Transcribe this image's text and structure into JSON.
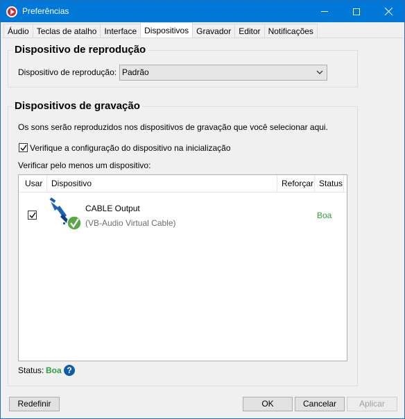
{
  "window": {
    "title": "Preferências"
  },
  "tabs": [
    {
      "label": "Áudio"
    },
    {
      "label": "Teclas de atalho"
    },
    {
      "label": "Interface"
    },
    {
      "label": "Dispositivos",
      "active": true
    },
    {
      "label": "Gravador"
    },
    {
      "label": "Editor"
    },
    {
      "label": "Notificações"
    }
  ],
  "playback": {
    "title": "Dispositivo de reprodução",
    "field_label": "Dispositivo de reprodução:",
    "selected": "Padrão"
  },
  "recording": {
    "title": "Dispositivos de gravação",
    "description": "Os sons serão reproduzidos nos dispositivos de gravação que você selecionar aqui.",
    "verify_startup_label": "Verifique a configuração do dispositivo na inicialização",
    "verify_startup_checked": true,
    "verify_one_label": "Verificar pelo menos um dispositivo:",
    "columns": {
      "use": "Usar",
      "device": "Dispositivo",
      "reinforce": "Reforçar",
      "status": "Status"
    },
    "devices": [
      {
        "checked": true,
        "name": "CABLE Output",
        "subtitle": "(VB-Audio Virtual Cable)",
        "status": "Boa",
        "icon": "cable-connector-icon"
      }
    ],
    "overall_status_label": "Status:",
    "overall_status_value": "Boa"
  },
  "buttons": {
    "reset": "Redefinir",
    "ok": "OK",
    "cancel": "Cancelar",
    "apply": "Aplicar"
  },
  "colors": {
    "titlebar": "#0078d7",
    "status_good": "#2e9f3e",
    "help_icon": "#0f5ea8"
  }
}
